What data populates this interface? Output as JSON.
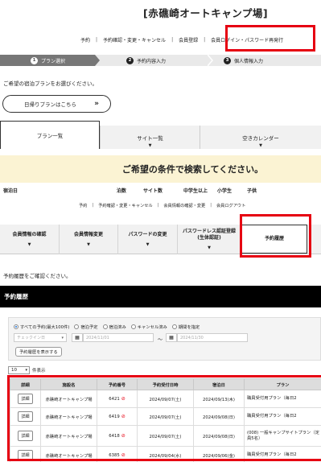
{
  "site_title": "[赤礁崎オートキャンプ場]",
  "nav1": [
    "予約",
    "予約確認・変更・キャンセル",
    "会員登録",
    "会員ログイン・パスワード再発行"
  ],
  "steps": [
    {
      "num": "1",
      "label": "プラン選択"
    },
    {
      "num": "2",
      "label": "予約内容入力"
    },
    {
      "num": "3",
      "label": "個人情報入力"
    }
  ],
  "intro_plan": "ご希望の宿泊プランをお選びください。",
  "day_plan_button": "日帰りプランはこちら",
  "day_plan_chevron": "»",
  "plan_tabs": [
    "プラン一覧",
    "サイト一覧",
    "空きカレンダー"
  ],
  "search_banner": "ご希望の条件で検索してください。",
  "criteria": [
    "宿泊日",
    "泊数",
    "サイト数",
    "中学生以上",
    "小学生",
    "子供"
  ],
  "nav2": [
    "予約",
    "予約確認・変更・キャンセル",
    "会員情報の確認・変更",
    "会員ログアウト"
  ],
  "member_tabs": [
    {
      "label": "会員情報の確認"
    },
    {
      "label": "会員情報変更"
    },
    {
      "label": "パスワードの変更"
    },
    {
      "label": "パスワードレス認証登録\n(生体認証)"
    },
    {
      "label": "予約履歴"
    }
  ],
  "intro_history": "予約履歴をご確認ください。",
  "history_title": "予約履歴",
  "filter": {
    "radios": [
      {
        "label": "すべての予約(最大100件)",
        "on": true
      },
      {
        "label": "宿泊予定",
        "on": false
      },
      {
        "label": "宿泊済み",
        "on": false
      },
      {
        "label": "キャンセル済み",
        "on": false
      },
      {
        "label": "期間を指定",
        "on": false
      }
    ],
    "dropdown_placeholder": "チェックイン日",
    "date_from": "2024/11/01",
    "date_sep": "〜",
    "date_to": "2024/11/30",
    "show_button": "予約履歴を表示する"
  },
  "per_page": {
    "value": "10",
    "suffix": "件表示"
  },
  "table": {
    "columns": [
      "詳細",
      "施設名",
      "予約番号",
      "予約受付日時",
      "宿泊日",
      "プラン"
    ],
    "detail_label": "詳細",
    "rows": [
      {
        "facility": "赤礁崎オートキャンプ場",
        "number": "6421",
        "received": "2024/09/07(土)",
        "stay": "2024/09/13(木)",
        "plan": "職員受付用プラン（毎日2"
      },
      {
        "facility": "赤礁崎オートキャンプ場",
        "number": "6419",
        "received": "2024/09/07(土)",
        "stay": "2024/09/08(日)",
        "plan": "職員受付用プラン（毎日2"
      },
      {
        "facility": "赤礁崎オートキャンプ場",
        "number": "6418",
        "received": "2024/09/07(土)",
        "stay": "2024/09/08(日)",
        "plan": "(008) 一般キャンプサイトプラン（定員5名）"
      },
      {
        "facility": "赤礁崎オートキャンプ場",
        "number": "6385",
        "received": "2024/09/04(水)",
        "stay": "2024/09/06(金)",
        "plan": "職員受付用プラン（毎日2"
      }
    ]
  },
  "colors": {
    "highlight": "#e60012",
    "active_step": "#777777",
    "banner_bg": "#fbf3d3",
    "header_bg": "#000000"
  }
}
